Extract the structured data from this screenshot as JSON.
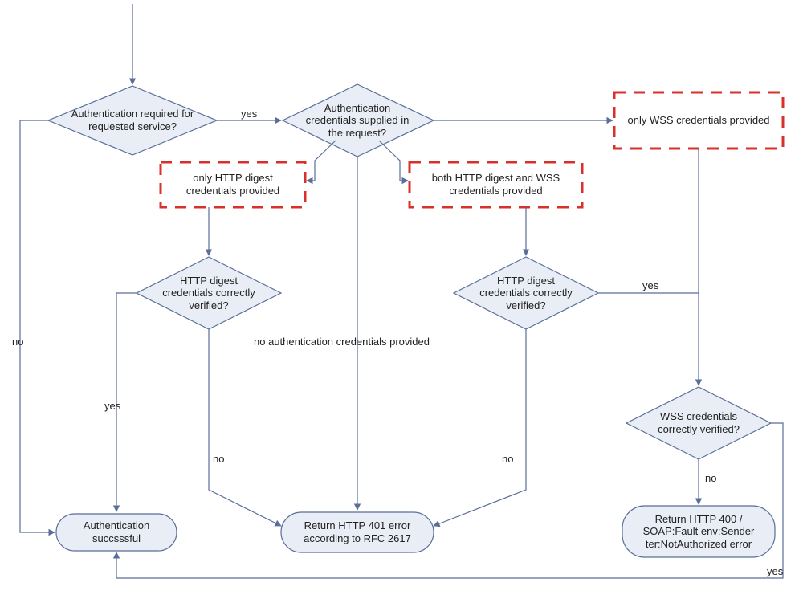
{
  "nodes": {
    "decision_auth_required": "Authentication required for requested service?",
    "decision_creds_supplied": "Authentication credentials supplied in the request?",
    "dashed_only_http": "only HTTP digest credentials provided",
    "dashed_both": "both HTTP digest and WSS credentials provided",
    "dashed_only_wss": "only WSS credentials provided",
    "decision_http_verified_left": "HTTP digest credentials correctly verified?",
    "decision_http_verified_right": "HTTP digest credentials correctly verified?",
    "decision_wss_verified": "WSS credentials correctly verified?",
    "term_auth_success": "Authentication succsssful",
    "term_http_401": "Return HTTP 401 error according to RFC 2617",
    "term_http_400": "Return HTTP 400 / SOAP:Fault env:Sender ter:NotAuthorized error"
  },
  "edge_labels": {
    "auth_required_yes": "yes",
    "auth_required_no": "no",
    "http_left_yes": "yes",
    "http_left_no": "no",
    "http_right_yes": "yes",
    "http_right_no": "no",
    "wss_yes": "yes",
    "wss_no": "no",
    "no_creds": "no authentication credentials provided"
  }
}
